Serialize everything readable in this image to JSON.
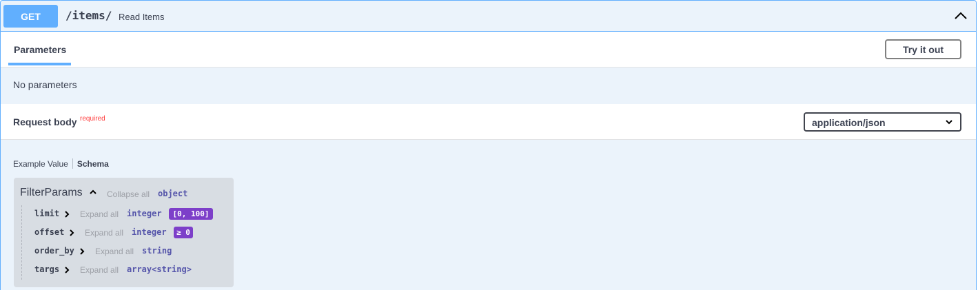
{
  "operation": {
    "method": "GET",
    "path": "/items/",
    "summary": "Read Items"
  },
  "parameters": {
    "tab_label": "Parameters",
    "try_button": "Try it out",
    "empty_text": "No parameters"
  },
  "request_body": {
    "title": "Request body",
    "required_label": "required",
    "content_type": "application/json"
  },
  "example_tabs": {
    "example_value": "Example Value",
    "schema": "Schema"
  },
  "schema": {
    "name": "FilterParams",
    "collapse_all": "Collapse all",
    "type": "object",
    "properties": [
      {
        "name": "limit",
        "expand_all": "Expand all",
        "type": "integer",
        "constraint": "[0, 100]"
      },
      {
        "name": "offset",
        "expand_all": "Expand all",
        "type": "integer",
        "constraint": "≥ 0"
      },
      {
        "name": "order_by",
        "expand_all": "Expand all",
        "type": "string",
        "constraint": ""
      },
      {
        "name": "targs",
        "expand_all": "Expand all",
        "type": "array<string>",
        "constraint": ""
      }
    ]
  },
  "colors": {
    "get_accent": "#61affe",
    "block_bg": "#ebf3fb",
    "required": "#ff3d3d",
    "constraint_badge": "#7d3fc9",
    "type_text": "#55a"
  },
  "icons": {
    "collapse": "chevron-up-icon",
    "select": "chevron-down-icon",
    "prop_expand": "chevron-right-icon"
  }
}
